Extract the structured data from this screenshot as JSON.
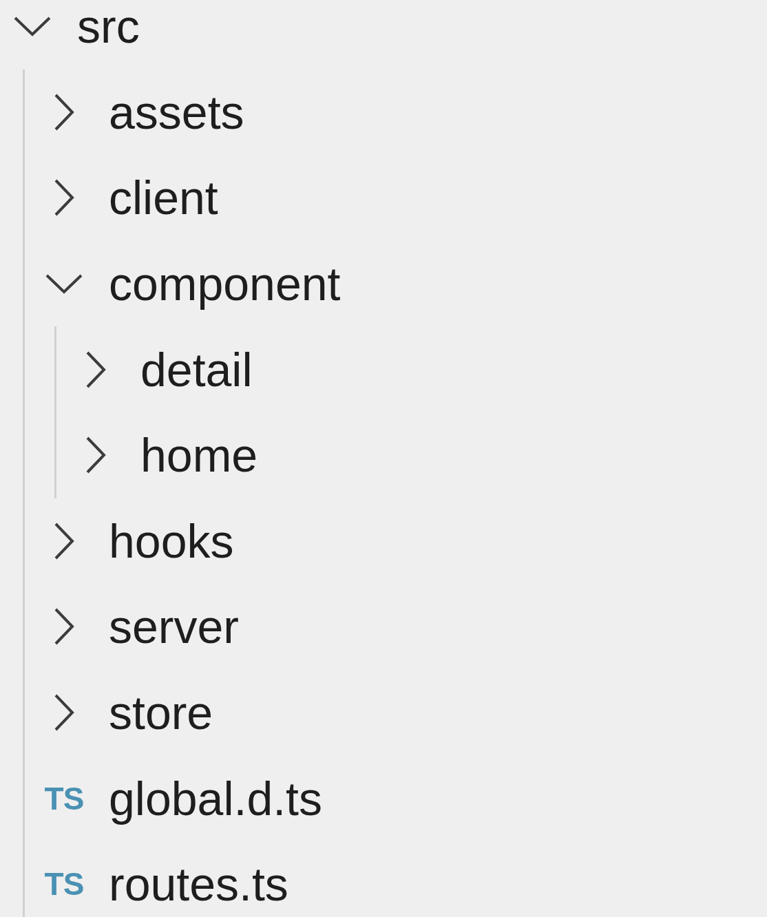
{
  "tree": [
    {
      "label": "src",
      "kind": "folder",
      "expanded": true,
      "children": [
        {
          "label": "assets",
          "kind": "folder",
          "expanded": false
        },
        {
          "label": "client",
          "kind": "folder",
          "expanded": false
        },
        {
          "label": "component",
          "kind": "folder",
          "expanded": true,
          "children": [
            {
              "label": "detail",
              "kind": "folder",
              "expanded": false
            },
            {
              "label": "home",
              "kind": "folder",
              "expanded": false
            }
          ]
        },
        {
          "label": "hooks",
          "kind": "folder",
          "expanded": false
        },
        {
          "label": "server",
          "kind": "folder",
          "expanded": false
        },
        {
          "label": "store",
          "kind": "folder",
          "expanded": false
        },
        {
          "label": "global.d.ts",
          "kind": "file",
          "icon_text": "TS"
        },
        {
          "label": "routes.ts",
          "kind": "file",
          "icon_text": "TS"
        }
      ]
    }
  ]
}
